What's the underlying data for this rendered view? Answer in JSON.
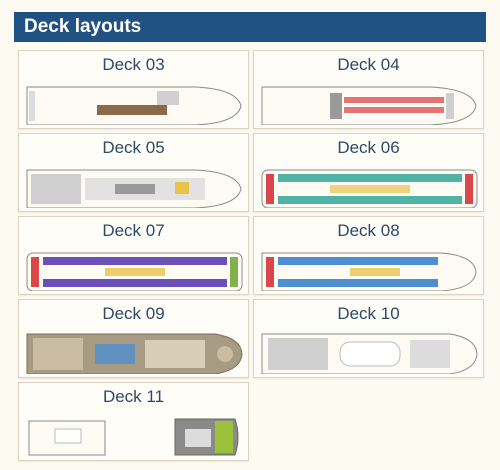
{
  "section": {
    "title": "Deck layouts"
  },
  "decks": [
    {
      "label": "Deck 03"
    },
    {
      "label": "Deck 04"
    },
    {
      "label": "Deck 05"
    },
    {
      "label": "Deck 06"
    },
    {
      "label": "Deck 07"
    },
    {
      "label": "Deck 08"
    },
    {
      "label": "Deck 09"
    },
    {
      "label": "Deck 10"
    },
    {
      "label": "Deck 11"
    }
  ],
  "colors": {
    "header": "#1f5283",
    "label": "#2c4a66",
    "hull_fill": "#fdfbf4",
    "hull_stroke": "#8a8a8a",
    "cabin_red": "#d9474a",
    "cabin_teal": "#4fb3a6",
    "cabin_blue": "#4e8fd0",
    "cabin_purple": "#6a4fb8",
    "cabin_yellow": "#e8c24a",
    "cabin_green": "#7fb24a",
    "deck_brown": "#8a6a4a"
  }
}
